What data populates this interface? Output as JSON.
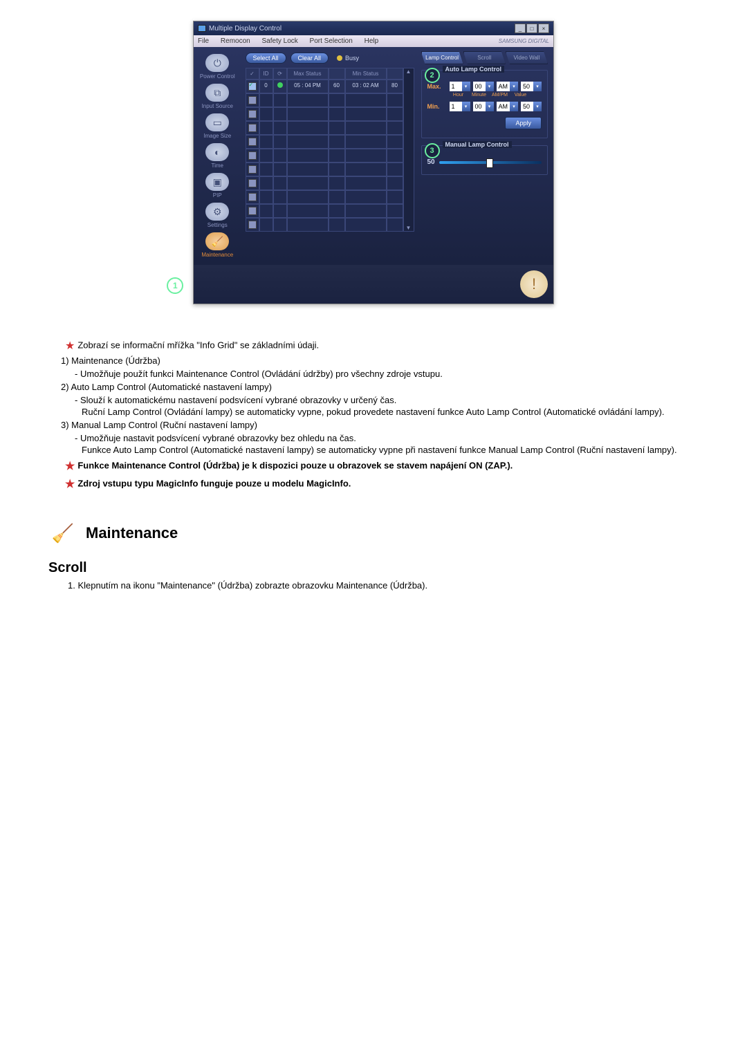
{
  "window": {
    "title": "Multiple Display Control",
    "brand": "SAMSUNG DIGITAL"
  },
  "menu": {
    "file": "File",
    "remocon": "Remocon",
    "safety_lock": "Safety Lock",
    "port_selection": "Port Selection",
    "help": "Help"
  },
  "sidebar": {
    "power": "Power Control",
    "input": "Input Source",
    "image": "Image Size",
    "time": "Time",
    "pip": "PIP",
    "settings": "Settings",
    "maintenance": "Maintenance",
    "badge1": "1"
  },
  "toolbar": {
    "select_all": "Select All",
    "clear_all": "Clear All",
    "busy": "Busy"
  },
  "grid": {
    "headers": {
      "chk": "✓",
      "id": "ID",
      "st": "",
      "max": "Max Status",
      "maxn": "",
      "min": "Min Status",
      "minn": ""
    },
    "row": {
      "id": "0",
      "max": "05 : 04 PM",
      "maxn": "60",
      "min": "03 : 02 AM",
      "minn": "80"
    }
  },
  "tabs": {
    "lamp": "Lamp Control",
    "scroll": "Scroll",
    "video": "Video Wall"
  },
  "auto": {
    "title": "Auto Lamp Control",
    "num": "2",
    "max_label": "Max.",
    "min_label": "Min.",
    "hour": "1",
    "minute": "00",
    "ampm": "AM",
    "value": "50",
    "sub_hour": "Hour",
    "sub_minute": "Minute",
    "sub_ampm": "AM/PM",
    "sub_value": "Value",
    "apply": "Apply"
  },
  "manual": {
    "title": "Manual Lamp Control",
    "num": "3",
    "value": "50"
  },
  "doc": {
    "p_star1": "Zobrazí se informační mřížka \"Info Grid\" se základními údaji.",
    "p1a": "1) Maintenance (Údržba)",
    "p1b": "- Umožňuje použít funkci Maintenance Control (Ovládání údržby) pro všechny zdroje vstupu.",
    "p2a": "2) Auto Lamp Control (Automatické nastavení lampy)",
    "p2b": "- Slouží k automatickému nastavení podsvícení vybrané obrazovky v určený čas.",
    "p2c": "Ruční Lamp Control (Ovládání lampy) se automaticky vypne, pokud provedete nastavení funkce Auto Lamp Control (Automatické ovládání lampy).",
    "p3a": "3) Manual Lamp Control (Ruční nastavení lampy)",
    "p3b": "- Umožňuje nastavit podsvícení vybrané obrazovky bez ohledu na čas.",
    "p3c": "Funkce Auto Lamp Control (Automatické nastavení lampy) se automaticky vypne při nastavení funkce Manual Lamp Control (Ruční nastavení lampy).",
    "b1": "Funkce Maintenance Control (Údržba) je k dispozici pouze u obrazovek se stavem napájení ON (ZAP.).",
    "b2": "Zdroj vstupu typu MagicInfo funguje pouze u modelu MagicInfo.",
    "heading": "Maintenance",
    "subheading": "Scroll",
    "n1": "1.  Klepnutím na ikonu \"Maintenance\" (Údržba) zobrazte obrazovku Maintenance (Údržba)."
  }
}
